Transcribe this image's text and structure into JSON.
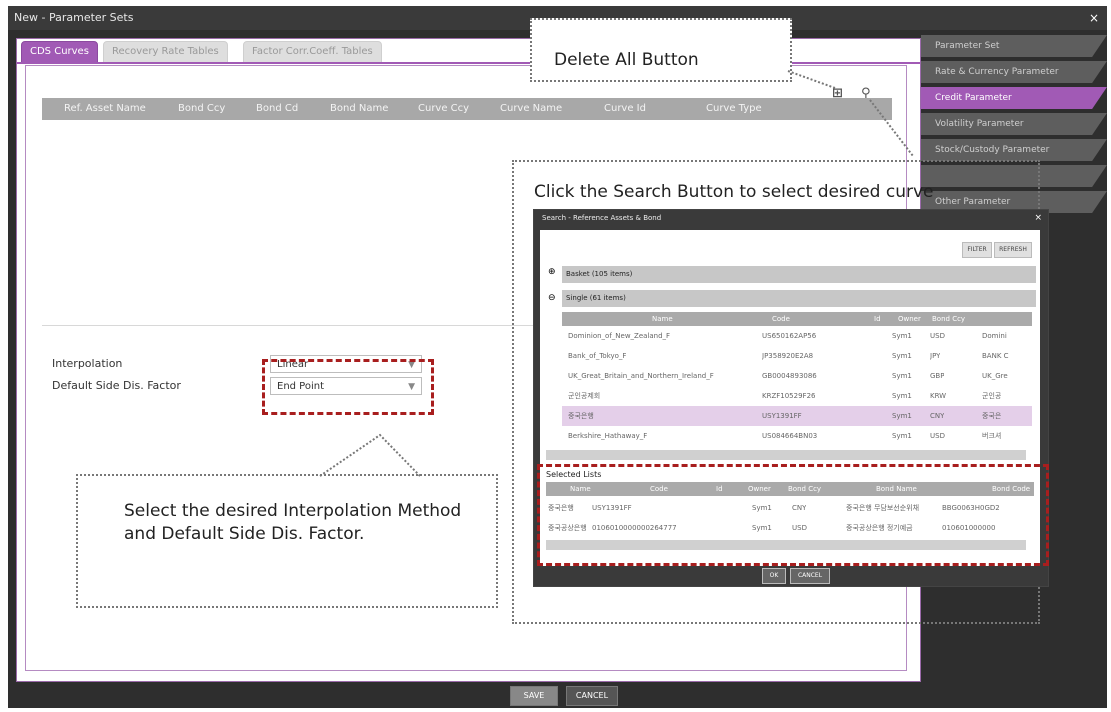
{
  "window": {
    "title": "New - Parameter Sets",
    "close": "×"
  },
  "tabs": [
    "CDS Curves",
    "Recovery Rate Tables",
    "Factor Corr.Coeff. Tables"
  ],
  "toolbar": {
    "delete_all_icon": "⊞",
    "search_icon": "⚲"
  },
  "grid": {
    "columns": [
      "Ref. Asset Name",
      "Bond Ccy",
      "Bond Cd",
      "Bond Name",
      "Curve Ccy",
      "Curve Name",
      "Curve Id",
      "Curve Type"
    ]
  },
  "form": {
    "interpolation_label": "Interpolation",
    "interpolation_value": "Linear",
    "default_side_label": "Default Side Dis. Factor",
    "default_side_value": "End Point"
  },
  "sidebar": {
    "items": [
      "Parameter Set",
      "Rate & Currency Parameter",
      "Credit Parameter",
      "Volatility Parameter",
      "Stock/Custody Parameter",
      "",
      "Other Parameter"
    ]
  },
  "footer": {
    "save": "SAVE",
    "cancel": "CANCEL"
  },
  "callouts": {
    "delete_all": "Delete All Button",
    "search": "Click the Search Button to select desired curve",
    "interp": "Select the desired Interpolation Method and Default Side Dis. Factor."
  },
  "search_dialog": {
    "title": "Search - Reference Assets & Bond",
    "filter": "FILTER",
    "refresh": "REFRESH",
    "groups": [
      {
        "toggle": "⊕",
        "label": "Basket (105 items)"
      },
      {
        "toggle": "⊖",
        "label": "Single (61 items)"
      }
    ],
    "columns": [
      "Name",
      "Code",
      "Id",
      "Owner",
      "Bond Ccy"
    ],
    "rows": [
      [
        "Dominion_of_New_Zealand_F",
        "US650162AP56",
        "",
        "Sym1",
        "USD",
        "Domini"
      ],
      [
        "Bank_of_Tokyo_F",
        "JP358920E2A8",
        "",
        "Sym1",
        "JPY",
        "BANK C"
      ],
      [
        "UK_Great_Britain_and_Northern_Ireland_F",
        "GB0004893086",
        "",
        "Sym1",
        "GBP",
        "UK_Gre"
      ],
      [
        "군인공제회",
        "KRZF10529F26",
        "",
        "Sym1",
        "KRW",
        "군인공"
      ],
      [
        "중국은행",
        "USY1391FF",
        "",
        "Sym1",
        "CNY",
        "중국은"
      ],
      [
        "Berkshire_Hathaway_F",
        "US084664BN03",
        "",
        "Sym1",
        "USD",
        "버크셔"
      ]
    ],
    "selected_label": "Selected Lists",
    "selected_columns": [
      "Name",
      "Code",
      "Id",
      "Owner",
      "Bond Ccy",
      "Bond Name",
      "Bond Code"
    ],
    "selected_rows": [
      [
        "중국은행",
        "USY1391FF",
        "",
        "Sym1",
        "CNY",
        "중국은행 무담보선순위채",
        "BBG0063H0GD2"
      ],
      [
        "중국공상은행",
        "0106010000000264777",
        "",
        "Sym1",
        "USD",
        "중국공상은행 정기예금",
        "010601000000"
      ]
    ],
    "ok": "OK",
    "cancel": "CANCEL"
  }
}
